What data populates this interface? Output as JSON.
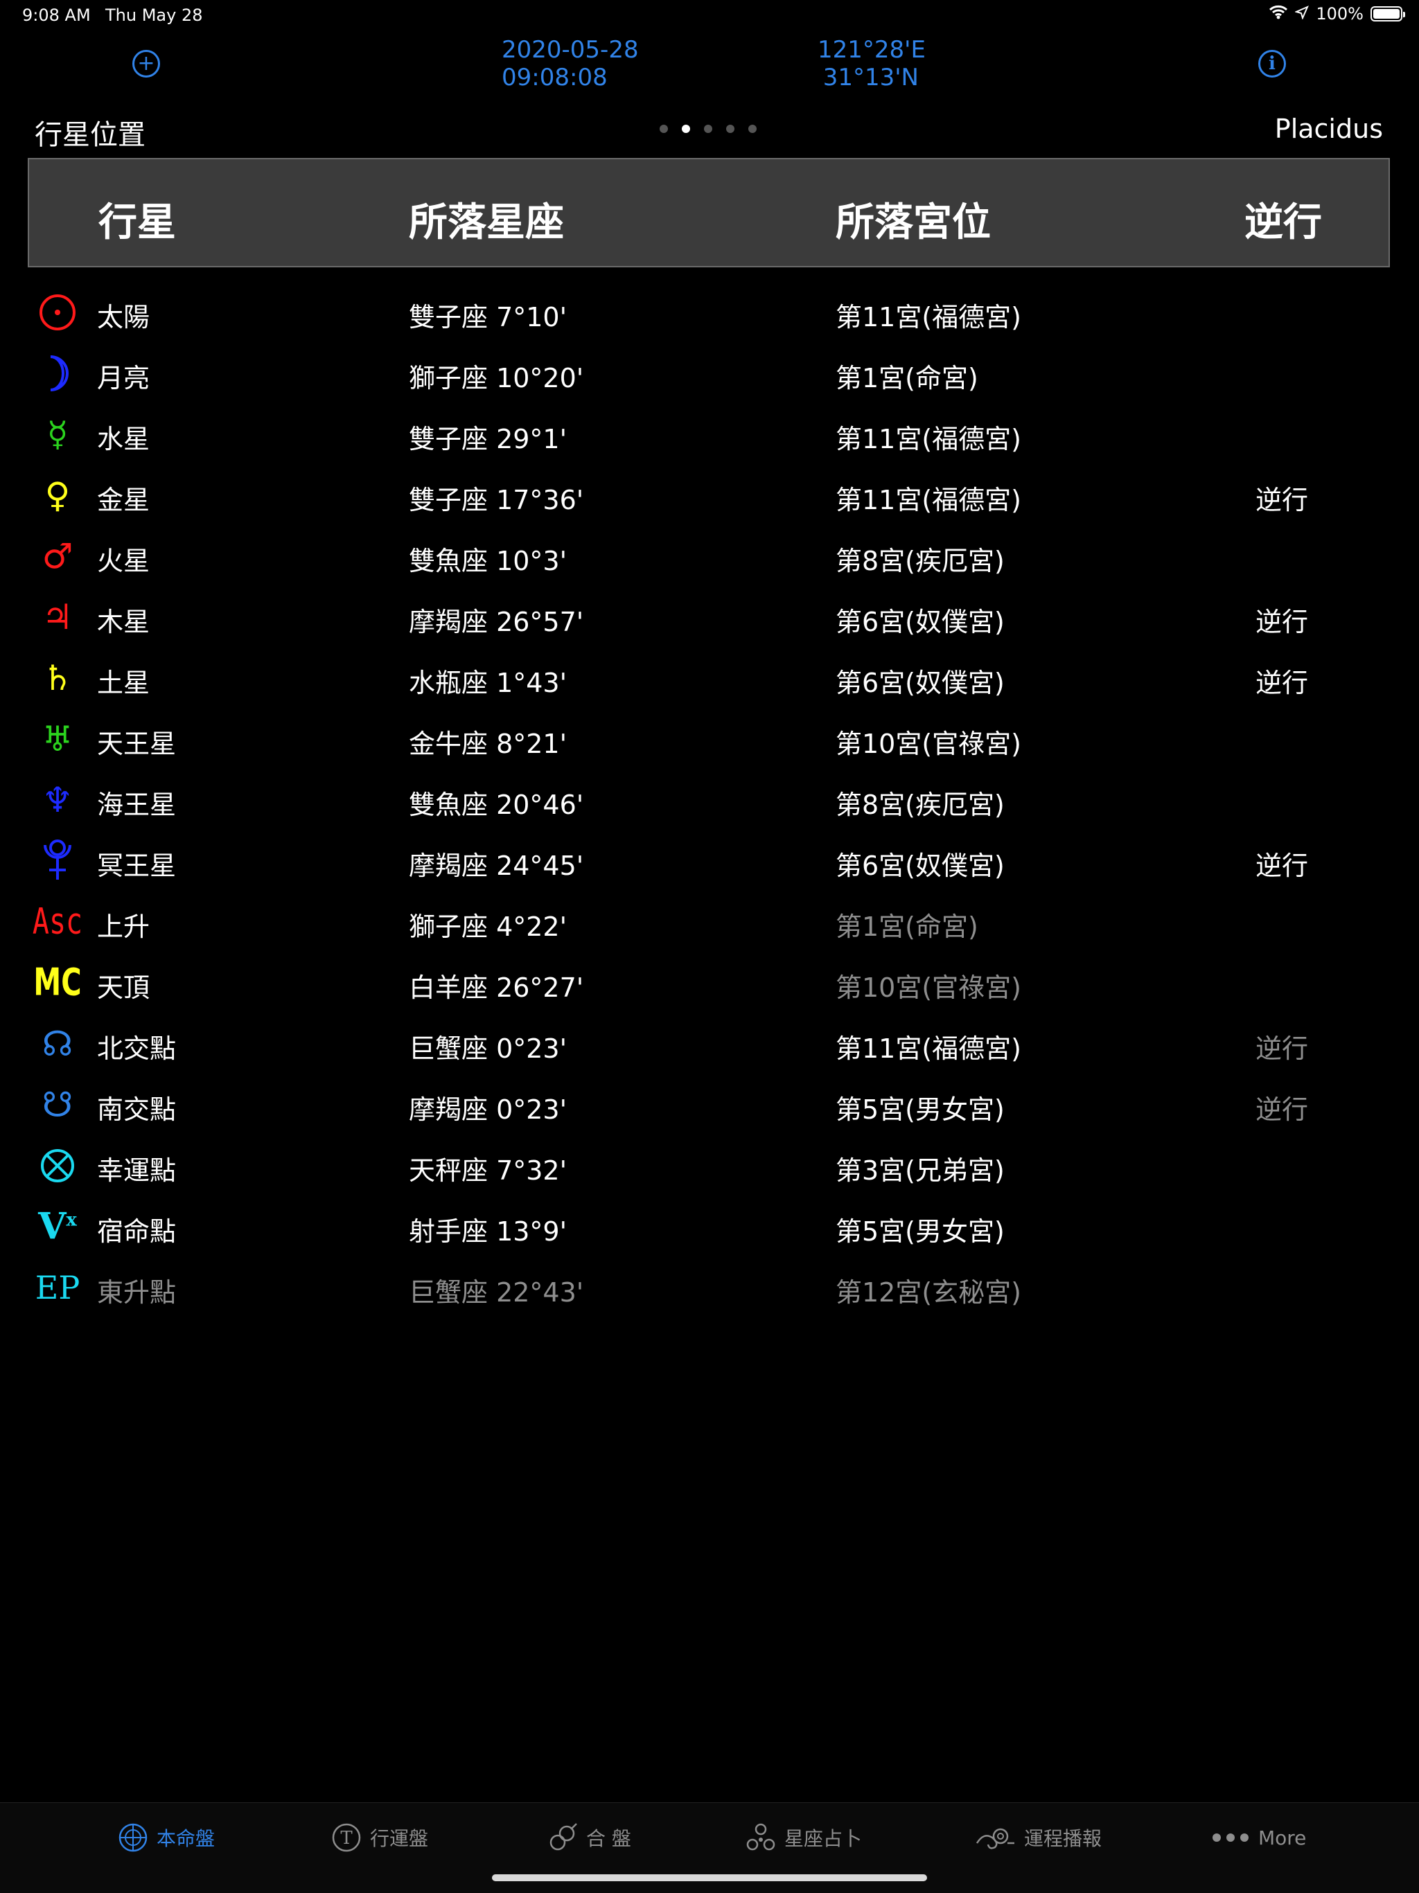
{
  "status_bar": {
    "time": "9:08 AM",
    "date": "Thu May 28",
    "battery": "100%"
  },
  "header": {
    "date": "2020-05-28",
    "time": "09:08:08",
    "longitude": "121°28'E",
    "latitude": "31°13'N"
  },
  "section": {
    "title": "行星位置",
    "house_system": "Placidus"
  },
  "page_dots": {
    "count": 5,
    "active_index": 1
  },
  "table": {
    "headers": [
      "行星",
      "所落星座",
      "所落宮位",
      "逆行"
    ],
    "rows": [
      {
        "icon": "sun-icon",
        "color": "#ff1a1a",
        "planet": "太陽",
        "sign": "雙子座 7°10'",
        "house": "第11宮(福德宮)",
        "retro": ""
      },
      {
        "icon": "moon-icon",
        "color": "#1d2bff",
        "planet": "月亮",
        "sign": "獅子座 10°20'",
        "house": "第1宮(命宮)",
        "retro": ""
      },
      {
        "icon": "mercury-icon",
        "color": "#2bd31e",
        "planet": "水星",
        "sign": "雙子座 29°1'",
        "house": "第11宮(福德宮)",
        "retro": ""
      },
      {
        "icon": "venus-icon",
        "color": "#ffff1a",
        "planet": "金星",
        "sign": "雙子座 17°36'",
        "house": "第11宮(福德宮)",
        "retro": "逆行"
      },
      {
        "icon": "mars-icon",
        "color": "#ff1a1a",
        "planet": "火星",
        "sign": "雙魚座 10°3'",
        "house": "第8宮(疾厄宮)",
        "retro": ""
      },
      {
        "icon": "jupiter-icon",
        "color": "#ff1a1a",
        "planet": "木星",
        "sign": "摩羯座 26°57'",
        "house": "第6宮(奴僕宮)",
        "retro": "逆行"
      },
      {
        "icon": "saturn-icon",
        "color": "#ffff1a",
        "planet": "土星",
        "sign": "水瓶座 1°43'",
        "house": "第6宮(奴僕宮)",
        "retro": "逆行"
      },
      {
        "icon": "uranus-icon",
        "color": "#2bd31e",
        "planet": "天王星",
        "sign": "金牛座 8°21'",
        "house": "第10宮(官祿宮)",
        "retro": ""
      },
      {
        "icon": "neptune-icon",
        "color": "#1d2bff",
        "planet": "海王星",
        "sign": "雙魚座 20°46'",
        "house": "第8宮(疾厄宮)",
        "retro": ""
      },
      {
        "icon": "pluto-icon",
        "color": "#1d2bff",
        "planet": "冥王星",
        "sign": "摩羯座 24°45'",
        "house": "第6宮(奴僕宮)",
        "retro": "逆行"
      },
      {
        "icon": "ascendant-icon",
        "color": "#ff1a1a",
        "planet": "上升",
        "sign": "獅子座 4°22'",
        "house": "第1宮(命宮)",
        "retro": "",
        "house_dim": true
      },
      {
        "icon": "midheaven-icon",
        "color": "#ffff1a",
        "planet": "天頂",
        "sign": "白羊座 26°27'",
        "house": "第10宮(官祿宮)",
        "retro": "",
        "house_dim": true
      },
      {
        "icon": "north-node-icon",
        "color": "#3183e8",
        "planet": "北交點",
        "sign": "巨蟹座 0°23'",
        "house": "第11宮(福德宮)",
        "retro": "逆行",
        "retro_dim": true
      },
      {
        "icon": "south-node-icon",
        "color": "#3183e8",
        "planet": "南交點",
        "sign": "摩羯座 0°23'",
        "house": "第5宮(男女宮)",
        "retro": "逆行",
        "retro_dim": true
      },
      {
        "icon": "part-of-fortune-icon",
        "color": "#1ad9f0",
        "planet": "幸運點",
        "sign": "天秤座 7°32'",
        "house": "第3宮(兄弟宮)",
        "retro": ""
      },
      {
        "icon": "vertex-icon",
        "color": "#1ad9f0",
        "planet": "宿命點",
        "sign": "射手座 13°9'",
        "house": "第5宮(男女宮)",
        "retro": ""
      },
      {
        "icon": "east-point-icon",
        "color": "#1ad9f0",
        "planet": "東升點",
        "sign": "巨蟹座 22°43'",
        "house": "第12宮(玄秘宮)",
        "retro": "",
        "all_dim": true
      }
    ]
  },
  "tabbar": {
    "tabs": [
      {
        "label": "本命盤",
        "icon": "natal-chart-icon",
        "active": true
      },
      {
        "label": "行運盤",
        "icon": "transit-chart-icon",
        "active": false
      },
      {
        "label": "合 盤",
        "icon": "synastry-chart-icon",
        "active": false
      },
      {
        "label": "星座占卜",
        "icon": "horoscope-icon",
        "active": false
      },
      {
        "label": "運程播報",
        "icon": "fortune-report-icon",
        "active": false
      },
      {
        "label": "More",
        "icon": "more-icon",
        "active": false
      }
    ]
  },
  "symbols": {
    "asc": "Asc",
    "mc": "MC",
    "vertex": "V",
    "vertex_sup": "x",
    "east_point": "EP"
  }
}
